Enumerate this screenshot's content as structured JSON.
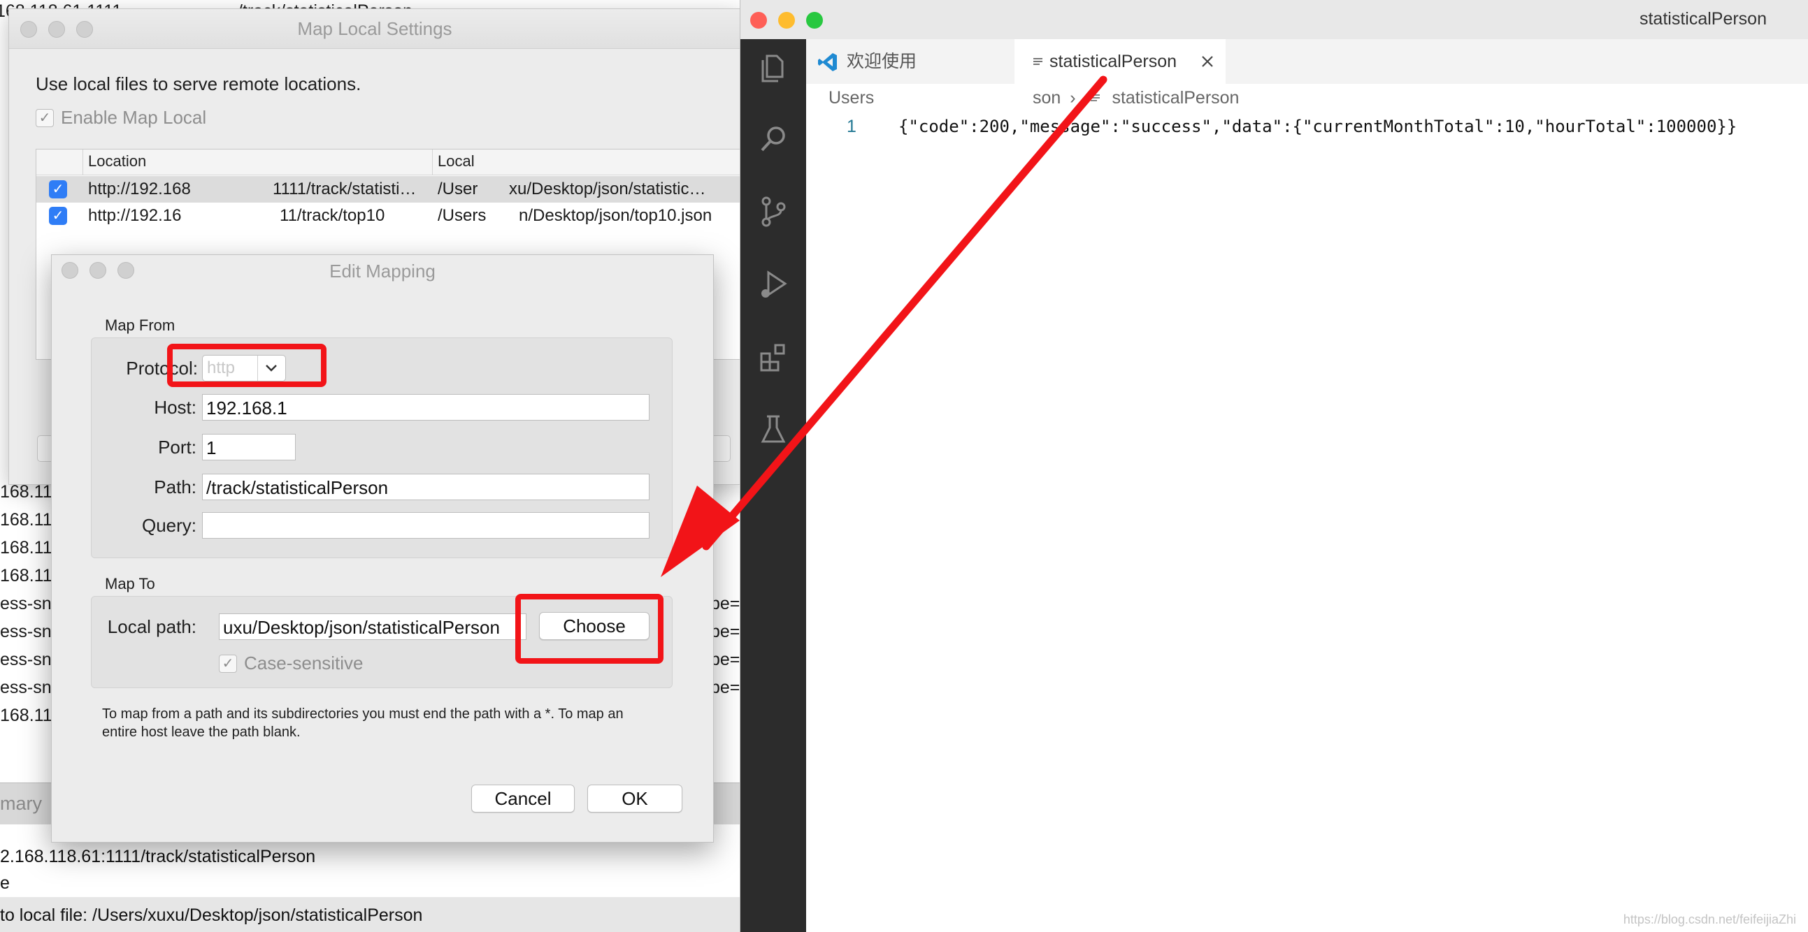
{
  "background_app": {
    "top_lines": [
      "168.118.61.1111",
      "/track/statisticalPerson"
    ],
    "list_lines": [
      "168.11",
      "168.11",
      "168.11",
      "168.11",
      "ess-sn",
      "ess-sn",
      "ess-sn",
      "ess-sn",
      "168.11"
    ],
    "right_lines": [
      "pe=",
      "pe=",
      "pe=",
      "pe="
    ],
    "summary_label": "mary",
    "bottom_lines": [
      "2.168.118.61:1111/track/statisticalPerson",
      "e",
      "to local file: /Users/xuxu/Desktop/json/statisticalPerson"
    ]
  },
  "map_local_settings": {
    "title": "Map Local Settings",
    "description": "Use local files to serve remote locations.",
    "enable_label": "Enable Map Local",
    "enable_checked": true,
    "columns": [
      "Location",
      "Local"
    ],
    "rows": [
      {
        "checked": true,
        "location": "http://192.168",
        "location_tail": "1111/track/statisti…",
        "local": "/User",
        "local_tail": "xu/Desktop/json/statistic…"
      },
      {
        "checked": true,
        "location": "http://192.16",
        "location_tail": "11/track/top10",
        "local": "/Users",
        "local_tail": "n/Desktop/json/top10.json"
      }
    ]
  },
  "edit_mapping": {
    "title": "Edit Mapping",
    "map_from_label": "Map From",
    "protocol_label": "Protocol:",
    "protocol_value": "http",
    "host_label": "Host:",
    "host_value": "192.168.1",
    "port_label": "Port:",
    "port_value": "1",
    "path_label": "Path:",
    "path_value": "/track/statisticalPerson",
    "query_label": "Query:",
    "query_value": "",
    "map_to_label": "Map To",
    "local_path_label": "Local path:",
    "local_path_value": "uxu/Desktop/json/statisticalPerson",
    "choose_label": "Choose",
    "case_sensitive_label": "Case-sensitive",
    "case_sensitive_checked": true,
    "note": "To map from a path and its subdirectories you must end the path with a *. To map an entire host leave the path blank.",
    "cancel_label": "Cancel",
    "ok_label": "OK"
  },
  "editor": {
    "window_title": "statisticalPerson",
    "tabs": [
      {
        "label": "欢迎使用",
        "icon": "vscode-logo-icon"
      },
      {
        "label": "statisticalPerson",
        "icon": "file-lines-icon",
        "active": true
      }
    ],
    "breadcrumb": [
      "Users",
      "son",
      "statisticalPerson"
    ],
    "line_number": "1",
    "code": "{\"code\":200,\"message\":\"success\",\"data\":{\"currentMonthTotal\":10,\"hourTotal\":100000}}",
    "watermark": "https://blog.csdn.net/feifeijiaZhi"
  },
  "colors": {
    "highlight": "#f21418",
    "accent_blue": "#2f7df6",
    "activity_bar": "#2c2c2c",
    "close": "#fe5f57",
    "minimize": "#febc2e",
    "zoom": "#28c840"
  }
}
